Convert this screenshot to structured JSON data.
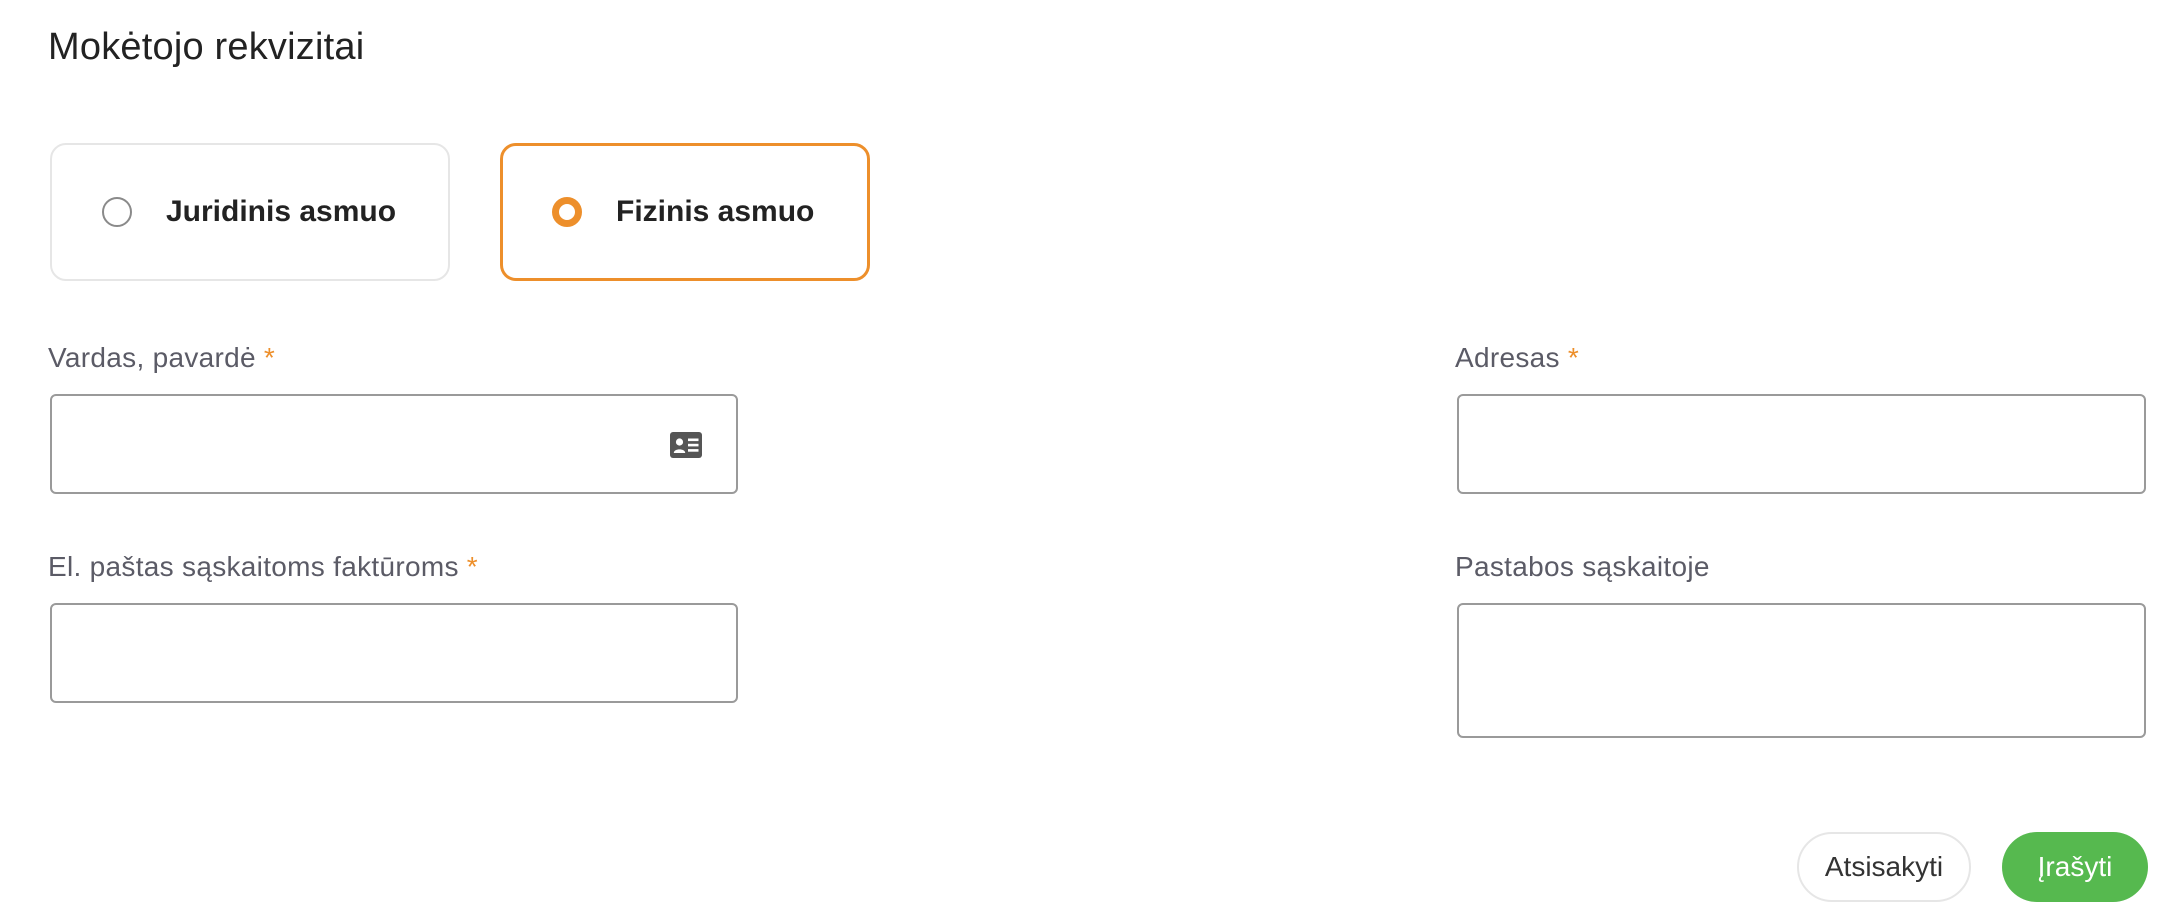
{
  "form": {
    "title": "Mokėtojo rekvizitai",
    "payer_types": [
      {
        "label": "Juridinis asmuo",
        "selected": false
      },
      {
        "label": "Fizinis asmuo",
        "selected": true
      }
    ],
    "required_mark": "*",
    "fields": {
      "name": {
        "label": "Vardas, pavardė",
        "value": "",
        "required": true,
        "icon": "id-card-icon"
      },
      "address": {
        "label": "Adresas",
        "value": "",
        "required": true
      },
      "email": {
        "label": "El. paštas sąskaitoms faktūroms",
        "value": "",
        "required": true
      },
      "notes": {
        "label": "Pastabos sąskaitoje",
        "value": "",
        "required": false
      }
    },
    "buttons": {
      "cancel": "Atsisakyti",
      "save": "Įrašyti"
    }
  },
  "colors": {
    "accent": "#ed8f2b",
    "save_button": "#56b94f",
    "label_text": "#5b5b66",
    "border": "#9a9a9a"
  }
}
